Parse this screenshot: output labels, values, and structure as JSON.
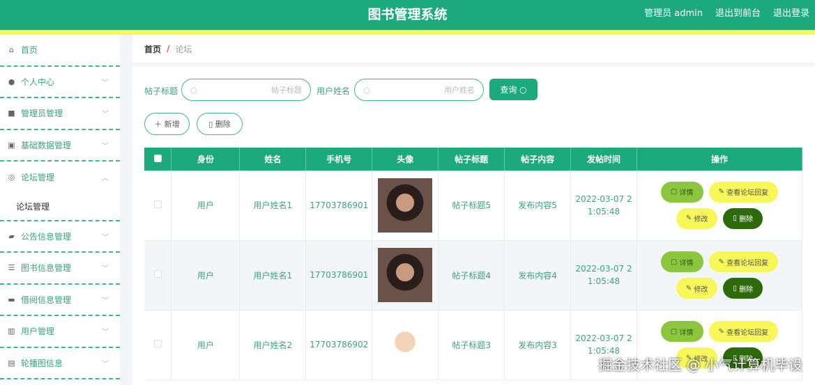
{
  "header": {
    "title": "图书管理系统",
    "user": "管理员 admin",
    "front": "退出到前台",
    "logout": "退出登录"
  },
  "sidebar": {
    "items": [
      {
        "label": "首页",
        "icon": "home-icon",
        "g": "⌂"
      },
      {
        "label": "个人中心",
        "icon": "user-icon",
        "g": "●"
      },
      {
        "label": "管理员管理",
        "icon": "briefcase-icon",
        "g": "■"
      },
      {
        "label": "基础数据管理",
        "icon": "chart-icon",
        "g": "▣"
      },
      {
        "label": "论坛管理",
        "icon": "compass-icon",
        "g": "◎",
        "open": true
      },
      {
        "label": "公告信息管理",
        "icon": "bag-icon",
        "g": "▰"
      },
      {
        "label": "图书信息管理",
        "icon": "sliders-icon",
        "g": "☰"
      },
      {
        "label": "借阅信息管理",
        "icon": "ticket-icon",
        "g": "▬"
      },
      {
        "label": "用户管理",
        "icon": "bar-chart-icon",
        "g": "▥"
      },
      {
        "label": "轮播图信息",
        "icon": "clipboard-icon",
        "g": "▤"
      }
    ],
    "sub": "论坛管理"
  },
  "breadcrumb": {
    "home": "首页",
    "sep": "/",
    "current": "论坛"
  },
  "search": {
    "title_label": "帖子标题",
    "title_placeholder": "帖子标题",
    "name_label": "用户姓名",
    "name_placeholder": "用户姓名",
    "query": "查询"
  },
  "actions": {
    "add": "新增",
    "delete": "删除"
  },
  "table": {
    "headers": [
      "身份",
      "姓名",
      "手机号",
      "头像",
      "帖子标题",
      "帖子内容",
      "发帖时间",
      "操作"
    ],
    "rows": [
      {
        "role": "用户",
        "name": "用户姓名1",
        "phone": "17703786901",
        "title": "帖子标题5",
        "content": "发布内容5",
        "time": "2022-03-07 2\n1:05:48"
      },
      {
        "role": "用户",
        "name": "用户姓名1",
        "phone": "17703786901",
        "title": "帖子标题4",
        "content": "发布内容4",
        "time": "2022-03-07 2\n1:05:48"
      },
      {
        "role": "用户",
        "name": "用户姓名2",
        "phone": "17703786902",
        "title": "帖子标题3",
        "content": "发布内容3",
        "time": "2022-03-07 2\n1:05:48"
      }
    ],
    "ops": {
      "detail": "详情",
      "reply": "查看论坛回复",
      "edit": "修改",
      "delete": "删除"
    }
  },
  "watermark": "掘金技术社区 @ 小气计算机毕设",
  "colors": {
    "primary": "#1ca97b",
    "yellow": "#f7f75a",
    "detail": "#8cc63f",
    "dark": "#2d6a0a"
  }
}
